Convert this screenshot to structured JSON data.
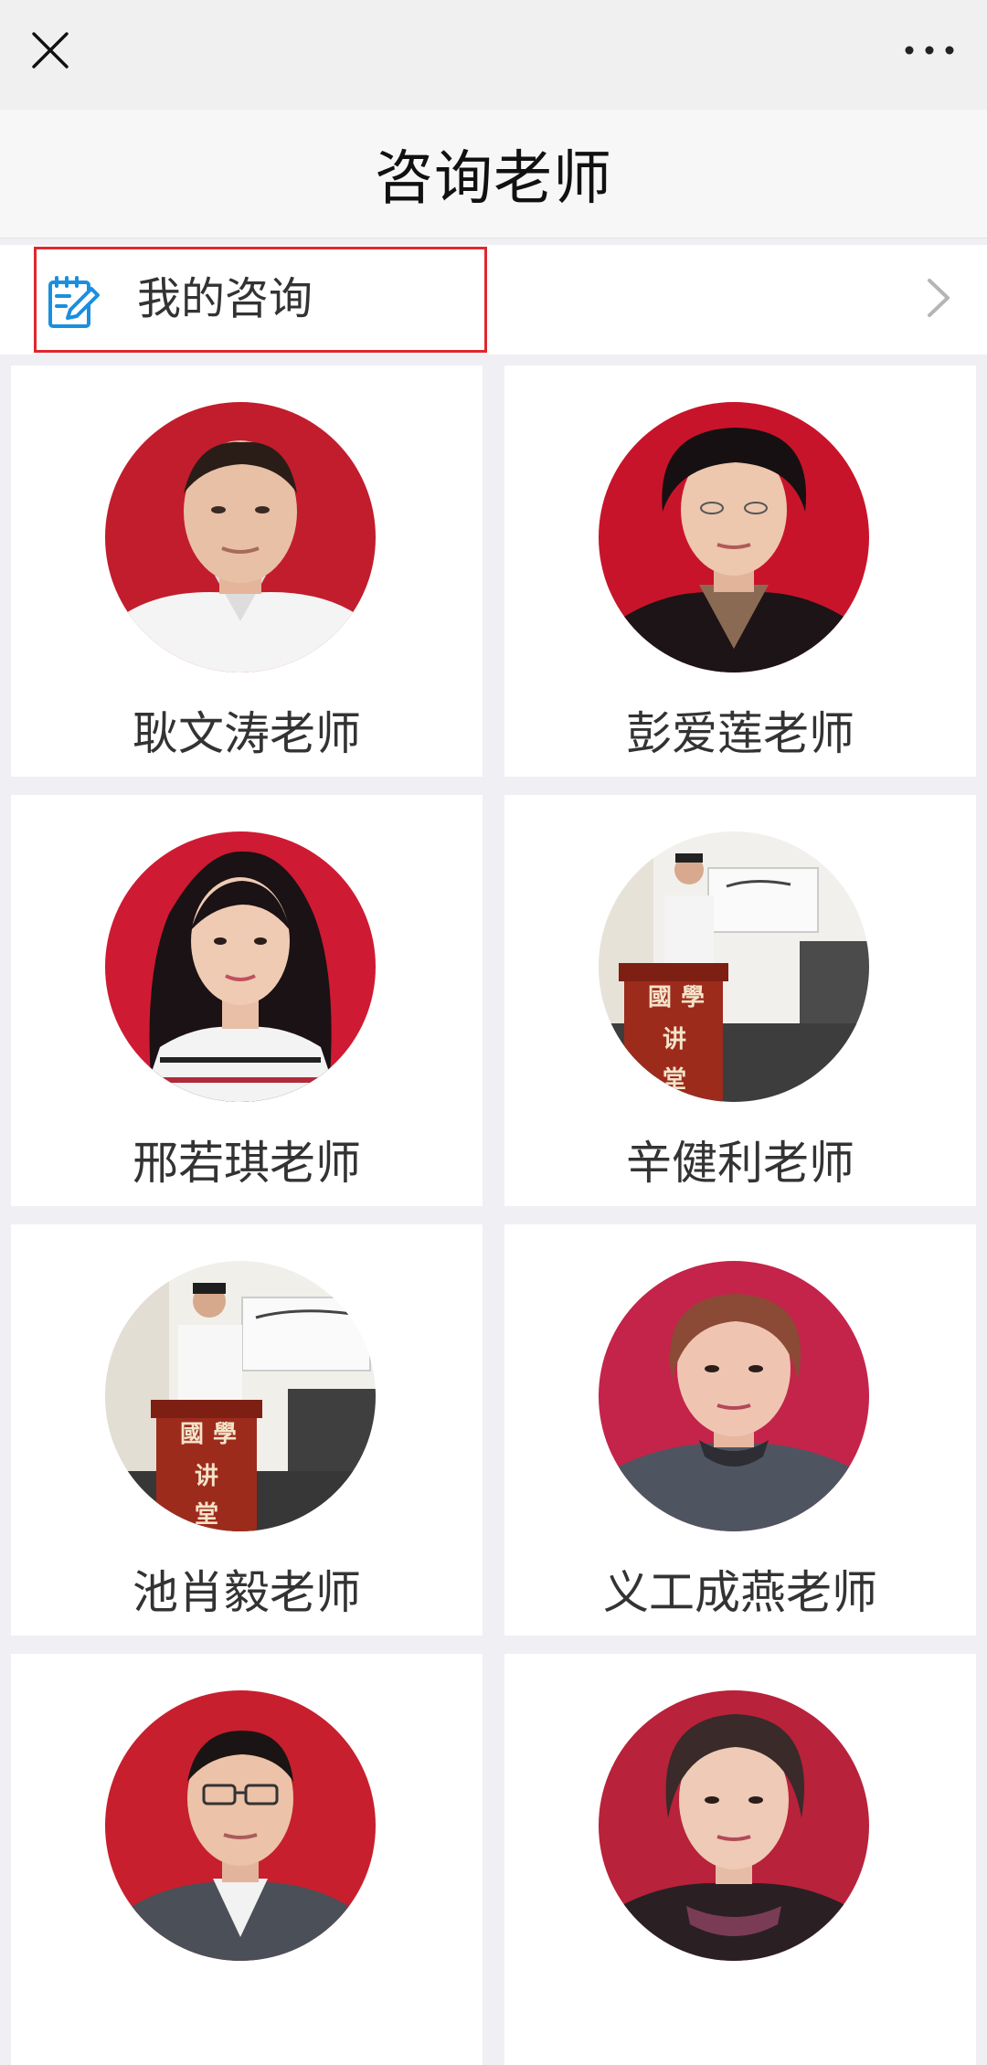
{
  "page": {
    "title": "咨询老师"
  },
  "topbar": {
    "close_icon": "close-icon",
    "more_icon": "more-dots-icon"
  },
  "my_consult": {
    "label": "我的咨询",
    "icon": "edit-note-icon",
    "accent_color": "#1a8fe0",
    "highlight_color": "#e0272d"
  },
  "teachers": [
    {
      "name": "耿文涛老师",
      "photo": "portrait-red-bg-man"
    },
    {
      "name": "彭爱莲老师",
      "photo": "portrait-red-bg-woman"
    },
    {
      "name": "邢若琪老师",
      "photo": "portrait-red-bg-woman-long-hair"
    },
    {
      "name": "辛健利老师",
      "photo": "lecture-podium-photo"
    },
    {
      "name": "池肖毅老师",
      "photo": "lecture-podium-photo"
    },
    {
      "name": "义工成燕老师",
      "photo": "portrait-red-bg-woman"
    },
    {
      "name": "",
      "photo": "portrait-red-bg-man-glasses"
    },
    {
      "name": "",
      "photo": "portrait-red-bg-woman-elder"
    }
  ],
  "podium_text": [
    "國",
    "學",
    "讲",
    "堂"
  ]
}
